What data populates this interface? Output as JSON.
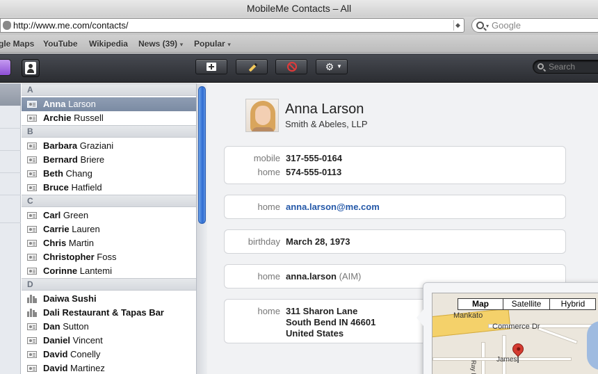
{
  "window": {
    "title": "MobileMe Contacts – All"
  },
  "browser": {
    "url": "http://www.me.com/contacts/",
    "search_placeholder": "Google",
    "bookmarks": [
      "gle Maps",
      "YouTube",
      "Wikipedia",
      "News (39)",
      "Popular"
    ]
  },
  "toolbar": {
    "search_placeholder": "Search"
  },
  "list": {
    "sections": [
      {
        "letter": "A",
        "rows": [
          {
            "first": "Anna",
            "last": "Larson",
            "type": "person",
            "selected": true
          },
          {
            "first": "Archie",
            "last": "Russell",
            "type": "person"
          }
        ]
      },
      {
        "letter": "B",
        "rows": [
          {
            "first": "Barbara",
            "last": "Graziani",
            "type": "person"
          },
          {
            "first": "Bernard",
            "last": "Briere",
            "type": "person"
          },
          {
            "first": "Beth",
            "last": "Chang",
            "type": "person"
          },
          {
            "first": "Bruce",
            "last": "Hatfield",
            "type": "person"
          }
        ]
      },
      {
        "letter": "C",
        "rows": [
          {
            "first": "Carl",
            "last": "Green",
            "type": "person"
          },
          {
            "first": "Carrie",
            "last": "Lauren",
            "type": "person"
          },
          {
            "first": "Chris",
            "last": "Martin",
            "type": "person"
          },
          {
            "first": "Christopher",
            "last": "Foss",
            "type": "person"
          },
          {
            "first": "Corinne",
            "last": "Lantemi",
            "type": "person"
          }
        ]
      },
      {
        "letter": "D",
        "rows": [
          {
            "first": "Daiwa Sushi",
            "last": "",
            "type": "company"
          },
          {
            "first": "Dali Restaurant & Tapas Bar",
            "last": "",
            "type": "company"
          },
          {
            "first": "Dan",
            "last": "Sutton",
            "type": "person"
          },
          {
            "first": "Daniel",
            "last": "Vincent",
            "type": "person"
          },
          {
            "first": "David",
            "last": "Conelly",
            "type": "person"
          },
          {
            "first": "David",
            "last": "Martinez",
            "type": "person"
          }
        ]
      }
    ]
  },
  "contact": {
    "name": "Anna Larson",
    "company": "Smith & Abeles, LLP",
    "phones": [
      {
        "label": "mobile",
        "value": "317-555-0164"
      },
      {
        "label": "home",
        "value": "574-555-0113"
      }
    ],
    "email": {
      "label": "home",
      "value": "anna.larson@me.com"
    },
    "birthday": {
      "label": "birthday",
      "value": "March 28, 1973"
    },
    "im": {
      "label": "home",
      "value": "anna.larson",
      "service": "(AIM)"
    },
    "address": {
      "label": "home",
      "line1": "311 Sharon Lane",
      "line2": "South Bend IN 46601",
      "line3": "United States"
    }
  },
  "map": {
    "tabs": [
      "Map",
      "Satellite",
      "Hybrid"
    ],
    "active_tab": "Map",
    "labels": {
      "city": "Mankato",
      "street1": "Commerce Dr",
      "street2": "Ray Dr",
      "street3": "James"
    }
  }
}
